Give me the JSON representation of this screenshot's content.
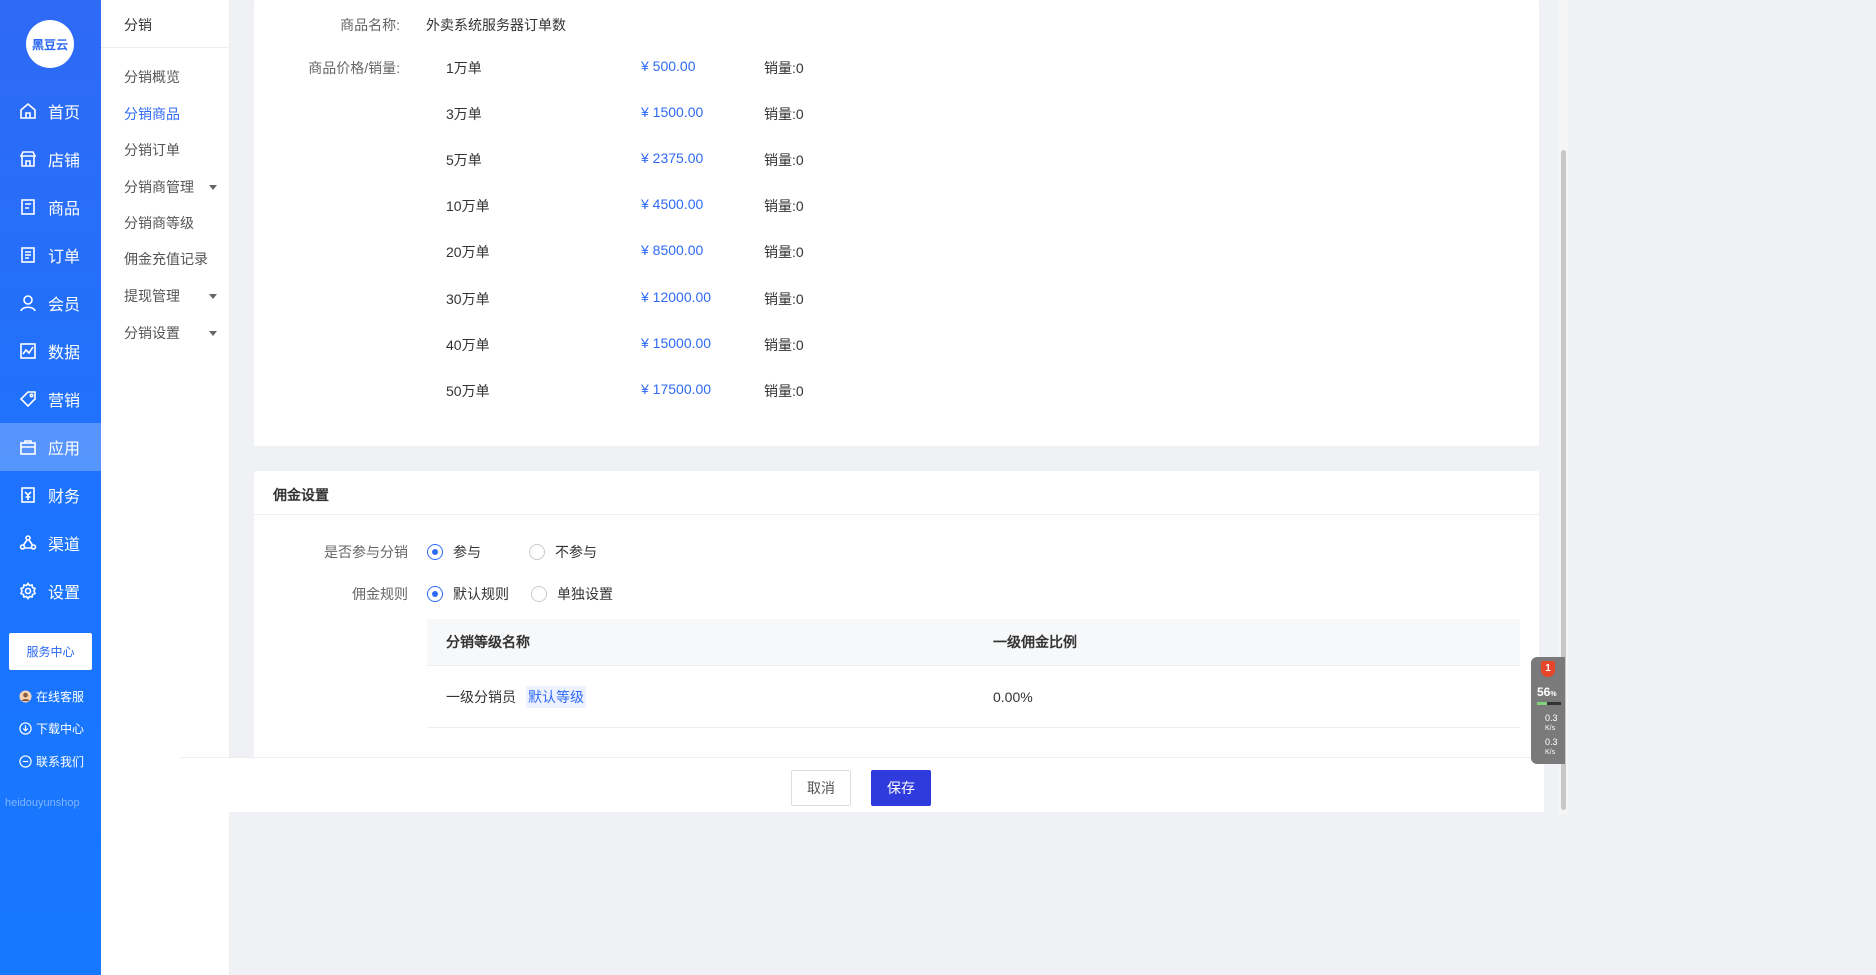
{
  "nav": {
    "logo": "黑豆云",
    "items": [
      {
        "label": "首页",
        "icon": "home-icon"
      },
      {
        "label": "店铺",
        "icon": "store-icon"
      },
      {
        "label": "商品",
        "icon": "goods-icon"
      },
      {
        "label": "订单",
        "icon": "order-icon"
      },
      {
        "label": "会员",
        "icon": "member-icon"
      },
      {
        "label": "数据",
        "icon": "data-icon"
      },
      {
        "label": "营销",
        "icon": "tag-icon"
      },
      {
        "label": "应用",
        "icon": "app-icon"
      },
      {
        "label": "财务",
        "icon": "finance-icon"
      },
      {
        "label": "渠道",
        "icon": "channel-icon"
      },
      {
        "label": "设置",
        "icon": "gear-icon"
      }
    ],
    "active_index": 7,
    "service_center": "服务中心",
    "online_service": "在线客服",
    "download_center": "下载中心",
    "contact_us": "联系我们",
    "watermark": "heidouyunshop"
  },
  "subnav": {
    "title": "分销",
    "items": [
      {
        "label": "分销概览",
        "has_caret": false
      },
      {
        "label": "分销商品",
        "has_caret": false,
        "active": true
      },
      {
        "label": "分销订单",
        "has_caret": false
      },
      {
        "label": "分销商管理",
        "has_caret": true
      },
      {
        "label": "分销商等级",
        "has_caret": false
      },
      {
        "label": "佣金充值记录",
        "has_caret": false
      },
      {
        "label": "提现管理",
        "has_caret": true
      },
      {
        "label": "分销设置",
        "has_caret": true
      }
    ]
  },
  "product": {
    "name_label": "商品名称:",
    "name_value": "外卖系统服务器订单数",
    "price_label": "商品价格/销量:",
    "sales_prefix": "销量:",
    "skus": [
      {
        "name": "1万单",
        "price": "¥ 500.00",
        "sales": "0"
      },
      {
        "name": "3万单",
        "price": "¥ 1500.00",
        "sales": "0"
      },
      {
        "name": "5万单",
        "price": "¥ 2375.00",
        "sales": "0"
      },
      {
        "name": "10万单",
        "price": "¥ 4500.00",
        "sales": "0"
      },
      {
        "name": "20万单",
        "price": "¥ 8500.00",
        "sales": "0"
      },
      {
        "name": "30万单",
        "price": "¥ 12000.00",
        "sales": "0"
      },
      {
        "name": "40万单",
        "price": "¥ 15000.00",
        "sales": "0"
      },
      {
        "name": "50万单",
        "price": "¥ 17500.00",
        "sales": "0"
      }
    ]
  },
  "commission": {
    "title": "佣金设置",
    "participate_label": "是否参与分销",
    "participate_options": [
      "参与",
      "不参与"
    ],
    "participate_selected": 0,
    "rule_label": "佣金规则",
    "rule_options": [
      "默认规则",
      "单独设置"
    ],
    "rule_selected": 0,
    "table": {
      "headers": [
        "分销等级名称",
        "一级佣金比例"
      ],
      "rows": [
        {
          "level": "一级分销员",
          "tag": "默认等级",
          "ratio": "0.00%"
        }
      ]
    }
  },
  "footer": {
    "cancel": "取消",
    "save": "保存"
  },
  "speed_widget": {
    "badge": "1",
    "percent": "56",
    "percent_unit": "%",
    "up": "0.3",
    "down": "0.3",
    "unit": "K/s"
  },
  "colors": {
    "accent": "#2f6af5",
    "save_button": "#2f3bdd",
    "nav_bg": "#1a74ff"
  }
}
